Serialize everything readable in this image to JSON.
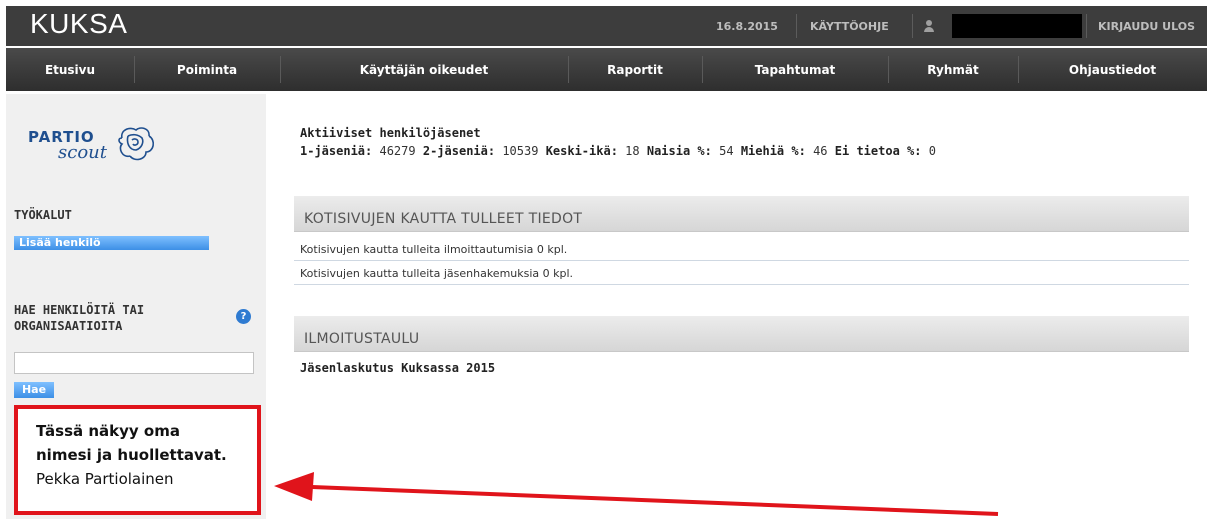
{
  "header": {
    "logo": "KUKSA",
    "date": "16.8.2015",
    "guide": "KÄYTTÖOHJE",
    "logout": "KIRJAUDU ULOS"
  },
  "nav": {
    "items": [
      {
        "label": "Etusivu"
      },
      {
        "label": "Poiminta"
      },
      {
        "label": "Käyttäjän oikeudet"
      },
      {
        "label": "Raportit"
      },
      {
        "label": "Tapahtumat"
      },
      {
        "label": "Ryhmät"
      },
      {
        "label": "Ohjaustiedot"
      }
    ]
  },
  "sidebar": {
    "brand_partio": "PARTIO",
    "brand_scout": "scout",
    "tools_heading": "TYÖKALUT",
    "add_person_label": "Lisää henkilö",
    "search_heading_line1": "HAE HENKILÖITÄ TAI",
    "search_heading_line2": "ORGANISAATIOITA",
    "help_symbol": "?",
    "search_value": "",
    "search_button": "Hae",
    "note_line1": "Tässä näkyy oma",
    "note_line2": "nimesi ja huollettavat.",
    "note_name": "Pekka Partiolainen"
  },
  "main": {
    "stats_title": "Aktiiviset henkilöjäsenet",
    "stats": {
      "one_members_label": "1-jäseniä:",
      "one_members_value": "46279",
      "two_members_label": "2-jäseniä:",
      "two_members_value": "10539",
      "avg_age_label": "Keski-ikä:",
      "avg_age_value": "18",
      "women_label": "Naisia %:",
      "women_value": "54",
      "men_label": "Miehiä %:",
      "men_value": "46",
      "unknown_label": "Ei tietoa %:",
      "unknown_value": "0"
    },
    "homepage_panel_title": "KOTISIVUJEN KAUTTA TULLEET TIEDOT",
    "homepage_rows": [
      "Kotisivujen kautta tulleita ilmoittautumisia 0 kpl.",
      "Kotisivujen kautta tulleita jäsenhakemuksia  0 kpl."
    ],
    "notice_panel_title": "ILMOITUSTAULU",
    "notice_item": "Jäsenlaskutus Kuksassa 2015"
  },
  "colors": {
    "header_bg": "#3d3d3d",
    "accent_blue": "#3d8fe6",
    "highlight_red": "#e0141b",
    "brand_blue": "#1f4f8f"
  },
  "icons": {
    "user": "user-icon",
    "help": "help-icon",
    "emblem": "scout-emblem-icon",
    "arrow": "red-arrow-annotation"
  }
}
